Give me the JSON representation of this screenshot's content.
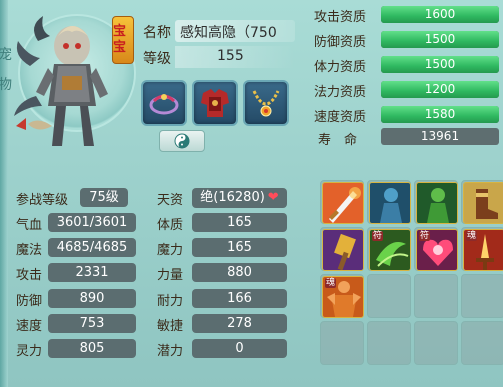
{
  "pet": {
    "badge": "宝宝",
    "name_label": "名称",
    "name_value": "感知高隐（750",
    "level_label": "等级",
    "level_value": "155"
  },
  "equipment": [
    {
      "name": "ring-equipment-icon"
    },
    {
      "name": "armor-equipment-icon"
    },
    {
      "name": "necklace-equipment-icon"
    }
  ],
  "aptitudes": [
    {
      "label": "攻击资质",
      "value": "1600",
      "fill": 1.0
    },
    {
      "label": "防御资质",
      "value": "1500",
      "fill": 1.0
    },
    {
      "label": "体力资质",
      "value": "1500",
      "fill": 1.0
    },
    {
      "label": "法力资质",
      "value": "1200",
      "fill": 1.0
    },
    {
      "label": "速度资质",
      "value": "1580",
      "fill": 1.0
    }
  ],
  "life": {
    "label": "寿　命",
    "value": "13961"
  },
  "stats_left": [
    {
      "label": "参战等级",
      "value": "75级"
    },
    {
      "label": "气血",
      "value": "3601/3601"
    },
    {
      "label": "魔法",
      "value": "4685/4685"
    },
    {
      "label": "攻击",
      "value": "2331"
    },
    {
      "label": "防御",
      "value": "890"
    },
    {
      "label": "速度",
      "value": "753"
    },
    {
      "label": "灵力",
      "value": "805"
    }
  ],
  "tianzi": {
    "label": "天资",
    "value": "绝(16280)"
  },
  "stats_right": [
    {
      "label": "体质",
      "value": "165"
    },
    {
      "label": "魔力",
      "value": "165"
    },
    {
      "label": "力量",
      "value": "880"
    },
    {
      "label": "耐力",
      "value": "166"
    },
    {
      "label": "敏捷",
      "value": "278"
    },
    {
      "label": "潜力",
      "value": "0"
    }
  ],
  "skill_tags": {
    "fu": "符",
    "hun": "魂"
  },
  "colors": {
    "apt_fill": "#2fb860",
    "stat_box": "#5b6d70",
    "heart": "#ff4c5a"
  }
}
